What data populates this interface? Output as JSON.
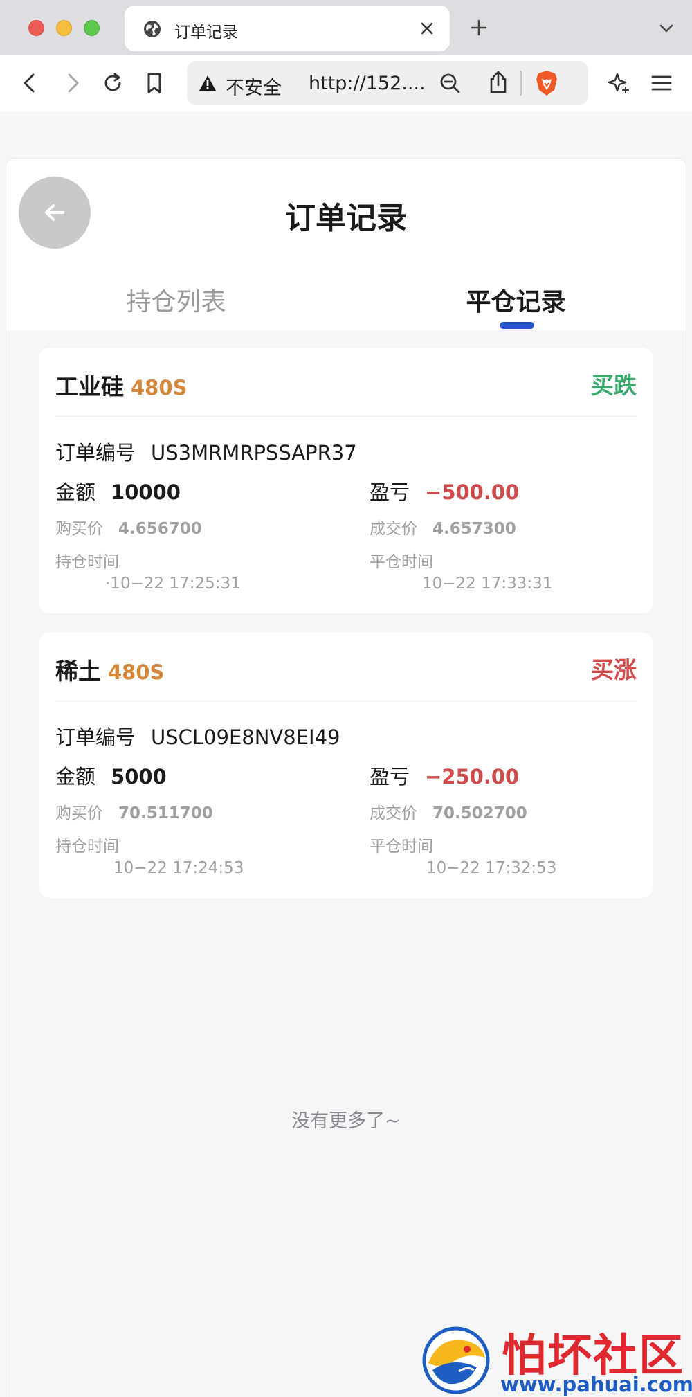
{
  "browser": {
    "tab_title": "订单记录",
    "not_secure_label": "不安全",
    "url": "http://152....",
    "colors": {
      "tabstrip": "#dedee2",
      "toolbar": "#ffffff"
    }
  },
  "page": {
    "title": "订单记录",
    "tabs": [
      {
        "label": "持仓列表",
        "active": false
      },
      {
        "label": "平仓记录",
        "active": true
      }
    ],
    "accent_color": "#2553c9"
  },
  "labels": {
    "order_no": "订单编号",
    "amount": "金额",
    "pnl": "盈亏",
    "buy_price": "购买价",
    "deal_price": "成交价",
    "hold_time": "持仓时间",
    "close_time": "平仓时间"
  },
  "orders": [
    {
      "name": "工业硅",
      "duration": "480S",
      "direction": "买跌",
      "direction_color": "#3aa96b",
      "order_no": "US3MRMRPSSAPR37",
      "amount": "10000",
      "pnl": "−500.00",
      "buy_price": "4.656700",
      "deal_price": "4.657300",
      "hold_time": "·10−22 17:25:31",
      "close_time": "10−22 17:33:31"
    },
    {
      "name": "稀土",
      "duration": "480S",
      "direction": "买涨",
      "direction_color": "#d44a4a",
      "order_no": "USCL09E8NV8EI49",
      "amount": "5000",
      "pnl": "−250.00",
      "buy_price": "70.511700",
      "deal_price": "70.502700",
      "hold_time": "10−22 17:24:53",
      "close_time": "10−22 17:32:53"
    }
  ],
  "footer": {
    "no_more": "没有更多了~"
  },
  "watermark": {
    "title": "怕坏社区",
    "url": "www.pahuai.com"
  }
}
